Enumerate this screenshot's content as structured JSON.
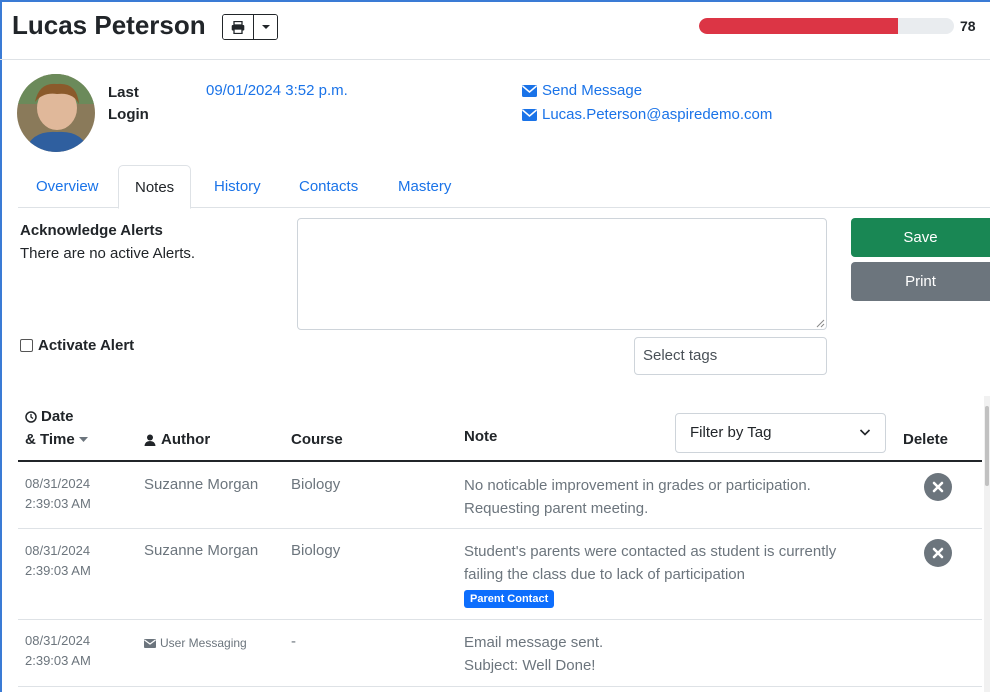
{
  "header": {
    "student_name": "Lucas Peterson",
    "progress_value": "78",
    "progress_fraction": 0.78,
    "progress_color": "#dc3545"
  },
  "profile": {
    "last_login_label": "Last Login",
    "last_login_value": "09/01/2024 3:52 p.m.",
    "send_message": "Send Message",
    "email": "Lucas.Peterson@aspiredemo.com"
  },
  "tabs": [
    {
      "label": "Overview",
      "active": false
    },
    {
      "label": "Notes",
      "active": true
    },
    {
      "label": "History",
      "active": false
    },
    {
      "label": "Contacts",
      "active": false
    },
    {
      "label": "Mastery",
      "active": false
    }
  ],
  "alerts": {
    "title": "Acknowledge Alerts",
    "text": "There are no active Alerts.",
    "activate_label": "Activate Alert"
  },
  "editor": {
    "note_value": "",
    "tags_placeholder": "Select tags",
    "save_label": "Save",
    "print_label": "Print"
  },
  "table": {
    "headers": {
      "date_line1": "Date",
      "date_line2": "& Time",
      "author": "Author",
      "course": "Course",
      "note": "Note",
      "filter": "Filter by Tag",
      "delete": "Delete"
    },
    "rows": [
      {
        "date": "08/31/2024",
        "time": "2:39:03 AM",
        "author": "Suzanne Morgan",
        "course": "Biology",
        "note_line1": "No noticable improvement in grades or participation.",
        "note_line2": "Requesting parent meeting.",
        "tag": ""
      },
      {
        "date": "08/31/2024",
        "time": "2:39:03 AM",
        "author": "Suzanne Morgan",
        "course": "Biology",
        "note_line1": "Student's parents were contacted as student is currently",
        "note_line2": "failing the class due to lack of participation",
        "tag": "Parent Contact"
      },
      {
        "date": "08/31/2024",
        "time": "2:39:03 AM",
        "author": "User Messaging",
        "course": "-",
        "note_line1": "Email message sent.",
        "note_line2": "Subject: Well Done!",
        "tag": ""
      }
    ]
  },
  "colors": {
    "link": "#1a73e8",
    "save": "#198754",
    "print": "#6c757d",
    "badge": "#0d6efd"
  }
}
